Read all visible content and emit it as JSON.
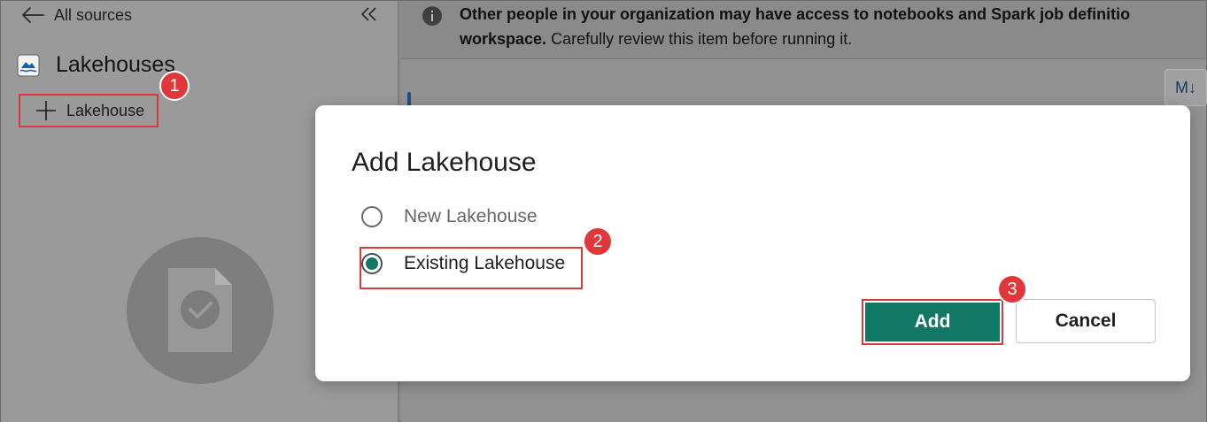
{
  "nav": {
    "back_label": "All sources"
  },
  "sidebar": {
    "section_title": "Lakehouses",
    "add_button_label": "Lakehouse"
  },
  "banner": {
    "line1": "Other people in your organization may have access to notebooks and Spark job definitio",
    "line2_bold": "workspace.",
    "line2_rest": " Carefully review this item  before running it."
  },
  "toolbar": {
    "markdown_label": "M↓"
  },
  "dialog": {
    "title": "Add Lakehouse",
    "options": [
      {
        "label": "New Lakehouse",
        "selected": false
      },
      {
        "label": "Existing Lakehouse",
        "selected": true
      }
    ],
    "add_label": "Add",
    "cancel_label": "Cancel"
  },
  "badges": {
    "step1": "1",
    "step2": "2",
    "step3": "3"
  },
  "colors": {
    "primary": "#117865",
    "highlight": "#d8393a",
    "badge": "#e0383a"
  },
  "icons": [
    "back-arrow-icon",
    "collapse-icon",
    "lakehouse-icon",
    "plus-icon",
    "document-check-icon",
    "info-icon"
  ]
}
